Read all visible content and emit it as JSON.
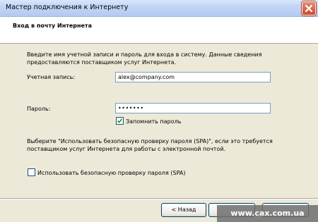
{
  "window": {
    "title": "Мастер подключения к Интернету"
  },
  "header": {
    "title": "Вход в почту Интернета"
  },
  "intro": {
    "line1": "Введите имя учетной записи и пароль для входа в систему. Данные сведения",
    "line2": "предоставляются поставщиком услуг Интернета."
  },
  "account": {
    "label": "Учетная запись:",
    "value": "alex@company.com"
  },
  "password": {
    "label": "Пароль:",
    "value": "•••••••"
  },
  "remember": {
    "label": "Запомнить пароль",
    "checked": true
  },
  "spa_note": {
    "line1": "Выберите \"Использовать безопасную проверку пароля (SPA)\", если это требуется",
    "line2": "поставщиком услуг Интернета для работы с электронной почтой."
  },
  "spa": {
    "label": "Использовать безопасную проверку пароля (SPA)",
    "checked": false
  },
  "buttons": {
    "back_label": "< Назад"
  },
  "watermark": {
    "text": "www.cax.com.ua"
  }
}
